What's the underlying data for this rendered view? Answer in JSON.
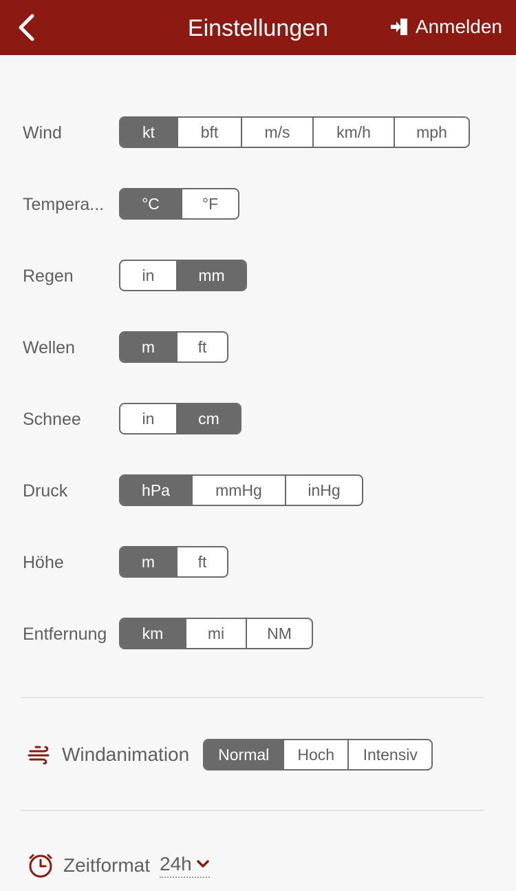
{
  "header": {
    "title": "Einstellungen",
    "login_label": "Anmelden",
    "background_color": "#8c1a12"
  },
  "units": {
    "wind": {
      "label": "Wind",
      "options": [
        "kt",
        "bft",
        "m/s",
        "km/h",
        "mph"
      ],
      "selected": "kt"
    },
    "temperature": {
      "label": "Tempera...",
      "options": [
        "°C",
        "°F"
      ],
      "selected": "°C"
    },
    "rain": {
      "label": "Regen",
      "options": [
        "in",
        "mm"
      ],
      "selected": "mm"
    },
    "waves": {
      "label": "Wellen",
      "options": [
        "m",
        "ft"
      ],
      "selected": "m"
    },
    "snow": {
      "label": "Schnee",
      "options": [
        "in",
        "cm"
      ],
      "selected": "cm"
    },
    "pressure": {
      "label": "Druck",
      "options": [
        "hPa",
        "mmHg",
        "inHg"
      ],
      "selected": "hPa"
    },
    "altitude": {
      "label": "Höhe",
      "options": [
        "m",
        "ft"
      ],
      "selected": "m"
    },
    "distance": {
      "label": "Entfernung",
      "options": [
        "km",
        "mi",
        "NM"
      ],
      "selected": "km"
    }
  },
  "wind_animation": {
    "label": "Windanimation",
    "options": [
      "Normal",
      "Hoch",
      "Intensiv"
    ],
    "selected": "Normal",
    "icon": "wind-icon"
  },
  "time_format": {
    "label": "Zeitformat",
    "value": "24h",
    "icon": "clock-icon"
  },
  "colors": {
    "accent": "#8c1a12",
    "selected_segment": "#6a6a6a",
    "text": "#5f5f5f",
    "background": "#f7f7f7"
  }
}
